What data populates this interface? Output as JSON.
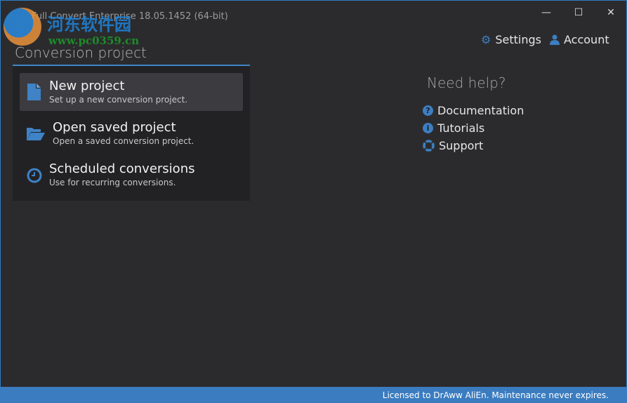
{
  "window": {
    "title": "Full Convert Enterprise 18.05.1452 (64-bit)",
    "minimize": "—",
    "maximize": "☐",
    "close": "✕"
  },
  "watermark": {
    "text_cn": "河东软件园",
    "url": "www.pc0359.cn"
  },
  "header": {
    "settings": "Settings",
    "account": "Account"
  },
  "section_title": "Conversion project",
  "items": [
    {
      "title": "New project",
      "subtitle": "Set up a new conversion project.",
      "icon": "file-icon"
    },
    {
      "title": "Open saved project",
      "subtitle": "Open a saved conversion project.",
      "icon": "folder-open-icon"
    },
    {
      "title": "Scheduled conversions",
      "subtitle": "Use for recurring conversions.",
      "icon": "clock-icon"
    }
  ],
  "help": {
    "title": "Need help?",
    "links": [
      "Documentation",
      "Tutorials",
      "Support"
    ]
  },
  "status": "Licensed to DrAww AliEn. Maintenance never expires.",
  "colors": {
    "accent": "#3d7fc0",
    "background": "#2b2b2e",
    "status_bar": "#3b7cc0"
  }
}
